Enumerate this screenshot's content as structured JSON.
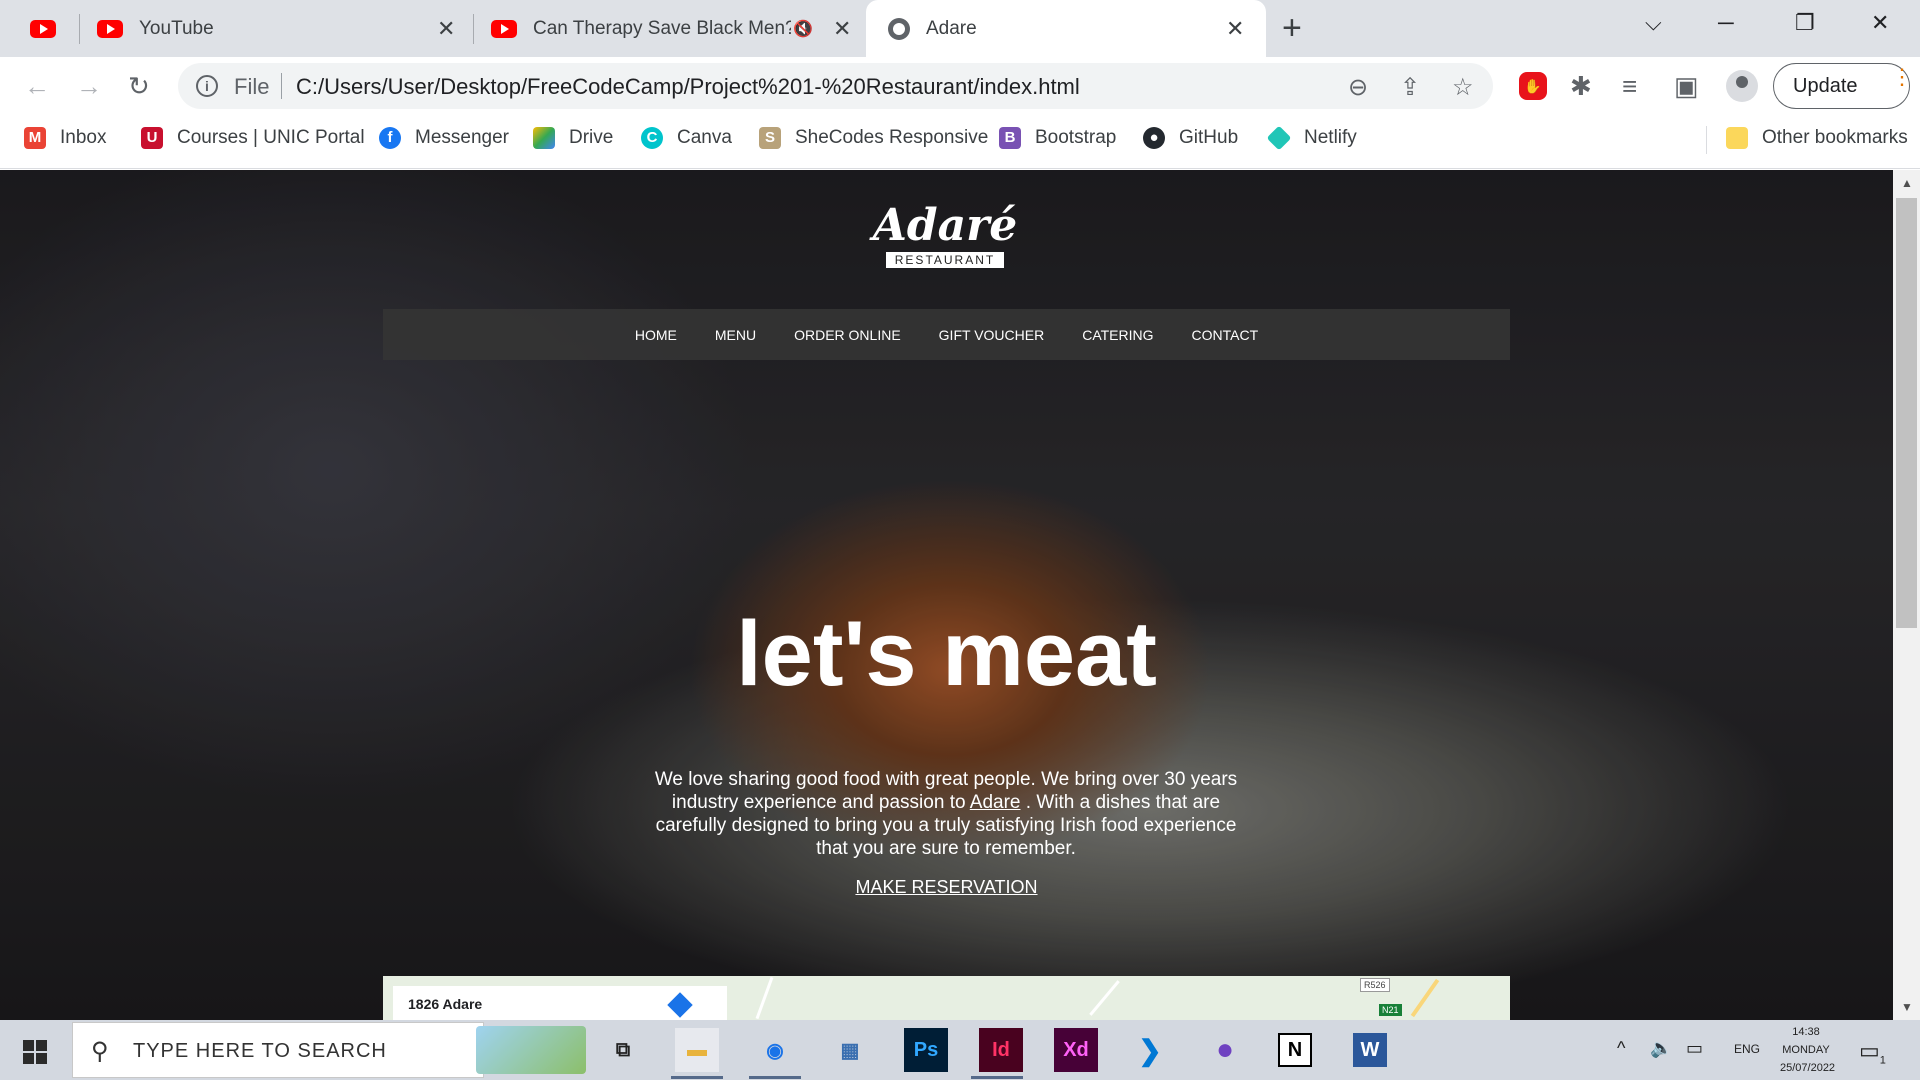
{
  "browser": {
    "tabs": [
      {
        "title": "",
        "pinned": true
      },
      {
        "title": "YouTube"
      },
      {
        "title": "Can Therapy Save Black Men? w"
      },
      {
        "title": "Adare",
        "active": true
      }
    ],
    "new_tab": "+",
    "window_controls": {
      "tab_search": "⌵",
      "minimize": "─",
      "restore": "❐",
      "close": "✕"
    },
    "toolbar": {
      "back": "←",
      "forward": "→",
      "reload": "↻",
      "file_label": "File",
      "url": "C:/Users/User/Desktop/FreeCodeCamp/Project%201-%20Restaurant/index.html",
      "update_label": "Update"
    },
    "bookmarks": [
      {
        "label": "Inbox",
        "icon": "gmail-icon",
        "color": "#ea4335"
      },
      {
        "label": "Courses | UNIC Portal",
        "icon": "unic-icon",
        "color": "#c8102e"
      },
      {
        "label": "Messenger",
        "icon": "facebook-icon",
        "color": "#1877f2"
      },
      {
        "label": "Drive",
        "icon": "drive-icon",
        "color": "#34a853"
      },
      {
        "label": "Canva",
        "icon": "canva-icon",
        "color": "#00c4cc"
      },
      {
        "label": "SheCodes Responsive",
        "icon": "shecodes-icon",
        "color": "#7d6b9e"
      },
      {
        "label": "Bootstrap",
        "icon": "bootstrap-icon",
        "color": "#7952b3"
      },
      {
        "label": "GitHub",
        "icon": "github-icon",
        "color": "#24292f"
      },
      {
        "label": "Netlify",
        "icon": "netlify-icon",
        "color": "#20c6b7"
      }
    ],
    "other_bookmarks": "Other bookmarks"
  },
  "site": {
    "logo": {
      "script": "Adaré",
      "sub": "RESTAURANT"
    },
    "nav": [
      "HOME",
      "MENU",
      "ORDER ONLINE",
      "GIFT VOUCHER",
      "CATERING",
      "CONTACT"
    ],
    "hero": {
      "title": "let's meat",
      "text_before": "We love sharing good food with great people. We bring over 30 years industry experience and passion to",
      "text_link": "Adare",
      "text_after": ". With a dishes that are carefully designed to bring you a truly satisfying Irish food experience that you are sure to remember.",
      "cta": "MAKE RESERVATION"
    },
    "map": {
      "place": "1826 Adare",
      "badge_r": "R526",
      "badge_n": "N21"
    }
  },
  "taskbar": {
    "search_placeholder": "Type here to search",
    "apps": [
      {
        "name": "task-view",
        "glyph": "⧉"
      },
      {
        "name": "file-explorer",
        "glyph": "▬"
      },
      {
        "name": "chrome",
        "glyph": "◉"
      },
      {
        "name": "calculator",
        "glyph": "▦"
      },
      {
        "name": "photoshop",
        "glyph": "Ps"
      },
      {
        "name": "indesign",
        "glyph": "Id"
      },
      {
        "name": "adobe-xd",
        "glyph": "Xd"
      },
      {
        "name": "vscode",
        "glyph": "❯"
      },
      {
        "name": "github-desktop",
        "glyph": "●"
      },
      {
        "name": "notion",
        "glyph": "N"
      },
      {
        "name": "word",
        "glyph": "W"
      }
    ],
    "tray": {
      "chevron": "^",
      "volume": "🔈",
      "battery": "▭",
      "language": "ENG"
    },
    "clock": {
      "time": "14:38",
      "day": "MONDAY",
      "date": "25/07/2022"
    },
    "notifications": "1"
  }
}
